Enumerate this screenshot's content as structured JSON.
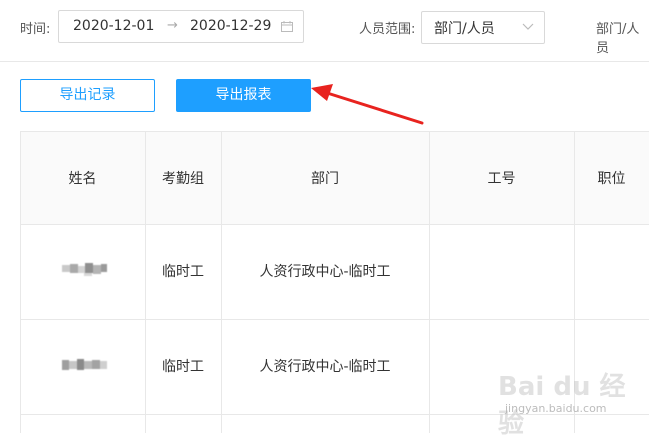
{
  "filters": {
    "time_label": "时间:",
    "date_start": "2020-12-01",
    "date_arrow": "→",
    "date_end": "2020-12-29",
    "scope_label": "人员范围:",
    "scope_value": "部门/人员",
    "extra_label": "部门/人员"
  },
  "buttons": {
    "export_records": "导出记录",
    "export_report": "导出报表"
  },
  "table": {
    "columns": [
      "姓名",
      "考勤组",
      "部门",
      "工号",
      "职位"
    ],
    "rows": [
      {
        "name": "",
        "group": "临时工",
        "department": "人资行政中心-临时工",
        "employee_id": "",
        "position": ""
      },
      {
        "name": "",
        "group": "临时工",
        "department": "人资行政中心-临时工",
        "employee_id": "",
        "position": ""
      }
    ]
  },
  "annotation": {
    "color": "#e8231f"
  },
  "watermark": {
    "text": "Bai du 经验",
    "sub": "jingyan.baidu.com"
  },
  "colors": {
    "primary": "#1e9fff",
    "border": "#d9d9d9",
    "header_bg": "#fafafa"
  }
}
